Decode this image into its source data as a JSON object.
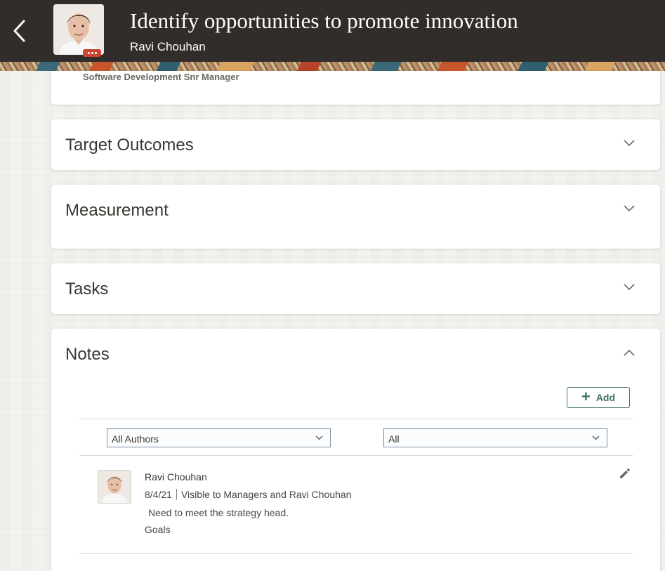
{
  "header": {
    "title": "Identify opportunities to promote innovation",
    "employee_name": "Ravi Chouhan"
  },
  "profile": {
    "job_title": "Software Development Snr Manager"
  },
  "sections": {
    "target_outcomes": "Target Outcomes",
    "measurement": "Measurement",
    "tasks": "Tasks",
    "notes": "Notes"
  },
  "notes": {
    "add_label": "Add",
    "author_filter": "All Authors",
    "visibility_filter": "All",
    "items": [
      {
        "author": "Ravi Chouhan",
        "date": "8/4/21",
        "visibility": "Visible to Managers and Ravi Chouhan",
        "text": "Need to meet the strategy head.",
        "category": "Goals"
      }
    ]
  },
  "icons": {
    "back": "chevron-left-icon",
    "expand": "chevron-down-icon",
    "collapse": "chevron-up-icon",
    "add": "plus-icon",
    "edit": "pencil-icon"
  },
  "colors": {
    "header_bg": "#312d2a",
    "accent_green": "#3f7461",
    "presence_badge": "#c74634"
  }
}
